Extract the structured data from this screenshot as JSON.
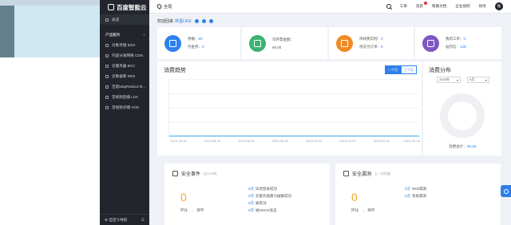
{
  "colors": {
    "accent": "#2f80ed",
    "sidebar": "#22252b",
    "warning": "#f5a623"
  },
  "brand": {
    "name": "百度智能云",
    "icon": "baidu-cloud-logo-icon"
  },
  "sidebar": {
    "home": "总览",
    "section": "产品服务",
    "items": [
      {
        "label": "对象存储 BOS",
        "icon": "storage-icon"
      },
      {
        "label": "内容分发网络 CDN",
        "icon": "cdn-icon"
      },
      {
        "label": "云服务器 BCC",
        "icon": "server-icon"
      },
      {
        "label": "云数据库 RDS",
        "icon": "database-icon"
      },
      {
        "label": "百度MapReduce B...",
        "icon": "mapreduce-icon"
      },
      {
        "label": "音视频直播 LSS",
        "icon": "live-icon"
      },
      {
        "label": "音视频点播 VOD",
        "icon": "vod-icon"
      }
    ],
    "footer": "自定义导航"
  },
  "header": {
    "region": "全局",
    "links": [
      "工单",
      "消息",
      "帮助文档",
      "企业组织",
      "财务"
    ],
    "avatar": "账"
  },
  "welcome": {
    "prefix": "欢迎回来",
    "user": "林墨LIKE"
  },
  "stats": [
    {
      "icon": "wallet-icon",
      "color": "#2f80ed",
      "lines": [
        {
          "k": "余额：",
          "v": "¥0"
        },
        {
          "k": "代金券：",
          "v": "0"
        }
      ]
    },
    {
      "icon": "invoice-icon",
      "color": "#3cb371",
      "lines": [
        {
          "k": "可开票金额：",
          "v": ""
        },
        {
          "k": "¥0.00",
          "v": ""
        }
      ]
    },
    {
      "icon": "order-icon",
      "color": "#f08a24",
      "lines": [
        {
          "k": "待续费实例：",
          "v": "0"
        },
        {
          "k": "待支付订单：",
          "v": "0"
        }
      ]
    },
    {
      "icon": "ticket-icon",
      "color": "#7e57c2",
      "lines": [
        {
          "k": "我的工单：",
          "v": "0"
        },
        {
          "k": "站内信：",
          "v": "128"
        }
      ]
    }
  ],
  "trend": {
    "title": "消费趋势",
    "tabs": [
      "一个月",
      "三个月"
    ],
    "xticks": [
      "2019-08-16",
      "2019-08-22",
      "2019-08-28",
      "2019-08-30",
      "2019-09-03",
      "2019-09-07",
      "2019-09-11",
      "2019-09-15"
    ]
  },
  "distribution": {
    "title": "消费分布",
    "year": "2019年",
    "month": "9月",
    "total_label": "消费总计：",
    "total_value": "¥0.00"
  },
  "security_events": {
    "title": "安全事件",
    "subtitle": "近24小时",
    "count": "0",
    "ring_label": "环比",
    "trend_label": "持平",
    "items": [
      {
        "n": "0次",
        "label": "异地登录成功"
      },
      {
        "n": "0次",
        "label": "云服务器暴力破解成功"
      },
      {
        "n": "0次",
        "label": "被黑词"
      },
      {
        "n": "0次",
        "label": "被DDOS攻击"
      }
    ]
  },
  "security_vulns": {
    "title": "安全漏洞",
    "subtitle": "上一次扫描",
    "count": "0",
    "ring_label": "环比",
    "trend_label": "持平",
    "items": [
      {
        "n": "0次",
        "label": "Web漏洞"
      },
      {
        "n": "0次",
        "label": "系统漏洞"
      }
    ]
  }
}
